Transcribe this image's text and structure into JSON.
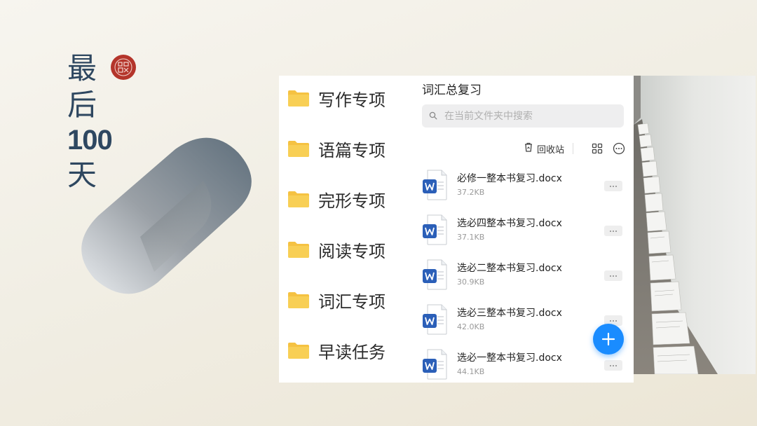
{
  "slide": {
    "title_chars": [
      "最",
      "后",
      "100",
      "天"
    ],
    "seal_icon": "red-seal-icon"
  },
  "folders": [
    {
      "label": "写作专项",
      "icon": "folder-icon"
    },
    {
      "label": "语篇专项",
      "icon": "folder-icon"
    },
    {
      "label": "完形专项",
      "icon": "folder-icon"
    },
    {
      "label": "阅读专项",
      "icon": "folder-icon"
    },
    {
      "label": "词汇专项",
      "icon": "folder-icon"
    },
    {
      "label": "早读任务",
      "icon": "folder-icon"
    }
  ],
  "file_panel": {
    "title": "词汇总复习",
    "search_placeholder": "在当前文件夹中搜索",
    "recycle_label": "回收站",
    "files": [
      {
        "name": "必修一整本书复习.docx",
        "size": "37.2KB"
      },
      {
        "name": "选必四整本书复习.docx",
        "size": "37.1KB"
      },
      {
        "name": "选必二整本书复习.docx",
        "size": "30.9KB"
      },
      {
        "name": "选必三整本书复习.docx",
        "size": "42.0KB"
      },
      {
        "name": "选必一整本书复习.docx",
        "size": "44.1KB"
      }
    ]
  },
  "colors": {
    "title": "#2e4760",
    "seal": "#b4352b",
    "folder": "#f5c242",
    "word_blue": "#2b5fb8",
    "fab": "#1a8cff"
  }
}
